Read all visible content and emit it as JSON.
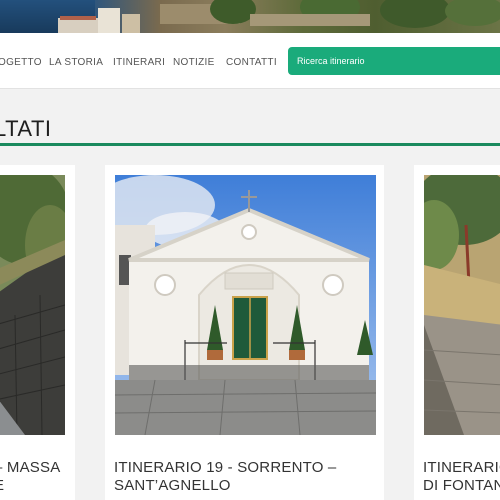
{
  "nav": {
    "links": [
      "OGETTO",
      "LA STORIA",
      "ITINERARI",
      "NOTIZIE",
      "CONTATTI"
    ],
    "search_placeholder": "Ricerca itinerario"
  },
  "section": {
    "heading": "LTATI"
  },
  "cards": [
    {
      "title_line1": "– MASSA",
      "title_line2": "E"
    },
    {
      "title_line1": "ITINERARIO 19 - SORRENTO –",
      "title_line2": "SANT’AGNELLO"
    },
    {
      "title_line1": "ITINERARIO",
      "title_line2": "DI FONTAN"
    }
  ],
  "colors": {
    "accent": "#1aab7b",
    "rule": "#1a8a5e",
    "background": "#f2f2f2"
  }
}
